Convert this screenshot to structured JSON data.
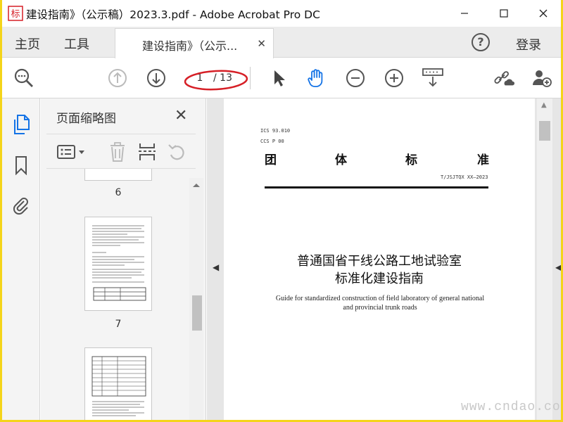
{
  "window": {
    "title": "建设指南》（公示稿）2023.3.pdf - Adobe Acrobat Pro DC",
    "app_icon_char": "标"
  },
  "tabs": {
    "home": "主页",
    "tools": "工具",
    "document": "建设指南》（公示...",
    "help": "?",
    "login": "登录"
  },
  "toolbar": {
    "page_current": "1",
    "page_total": "/ 13"
  },
  "thumbnails_panel": {
    "title": "页面缩略图",
    "pages": [
      {
        "number": "6"
      },
      {
        "number": "7"
      },
      {
        "number": ""
      }
    ]
  },
  "document": {
    "ics": "ICS 93.010",
    "ccs": "CCS P 00",
    "standard_chars": [
      "团",
      "体",
      "标",
      "准"
    ],
    "std_code": "T/JSJTQX XX—2023",
    "title_line1": "普通国省干线公路工地试验室",
    "title_line2": "标准化建设指南",
    "english_title_line1": "Guide for standardized construction of field laboratory of general national",
    "english_title_line2": "and provincial trunk roads"
  },
  "watermark": "www.cndao.com",
  "colors": {
    "frame": "#f4d41a",
    "accent_blue": "#1473e6",
    "annotation_red": "#d61f26"
  }
}
